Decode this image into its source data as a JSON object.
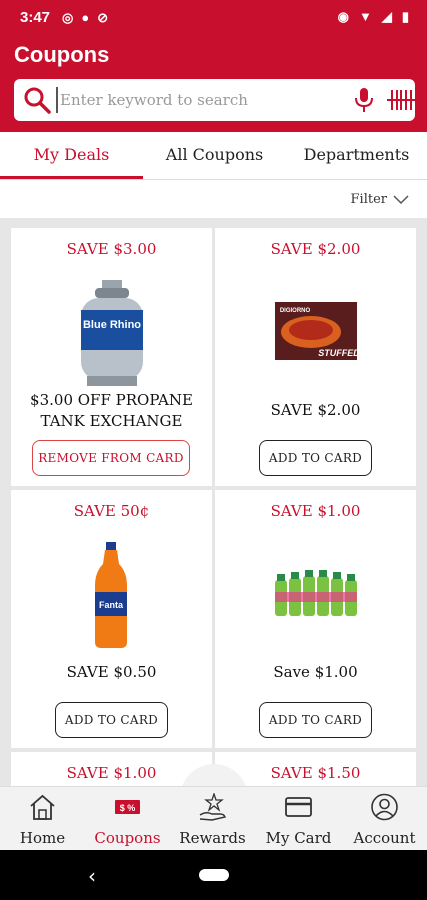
{
  "status_bar": {
    "time": "3:47"
  },
  "header": {
    "title": "Coupons"
  },
  "search": {
    "placeholder": "Enter keyword to search"
  },
  "tabs": [
    {
      "label": "My Deals"
    },
    {
      "label": "All Coupons"
    },
    {
      "label": "Departments"
    }
  ],
  "filter": {
    "label": "Filter"
  },
  "coupons": [
    {
      "save": "SAVE $3.00",
      "desc": "$3.00 OFF PROPANE TANK EXCHANGE",
      "button": "REMOVE FROM CARD",
      "product": "Blue Rhino propane tank",
      "logo_text": "Blue Rhino"
    },
    {
      "save": "SAVE $2.00",
      "desc": "SAVE $2.00",
      "button": "ADD TO CARD",
      "product": "DiGiorno stuffed crust pizza",
      "logo_text": "DIGIORNO",
      "box_text": "STUFFED"
    },
    {
      "save": "SAVE 50¢",
      "desc": "SAVE $0.50",
      "button": "ADD TO CARD",
      "product": "Fanta orange bottle",
      "logo_text": "Fanta"
    },
    {
      "save": "SAVE $1.00",
      "desc": "Save $1.00",
      "button": "ADD TO CARD",
      "product": "Green sports drink multipack"
    },
    {
      "save": "SAVE $1.00"
    },
    {
      "save": "SAVE $1.50"
    }
  ],
  "bottom_nav": [
    {
      "label": "Home",
      "icon": "home-icon"
    },
    {
      "label": "Coupons",
      "icon": "coupons-icon",
      "badge": "$ %"
    },
    {
      "label": "Rewards",
      "icon": "rewards-icon"
    },
    {
      "label": "My Card",
      "icon": "card-icon"
    },
    {
      "label": "Account",
      "icon": "account-icon"
    }
  ],
  "colors": {
    "brand": "#c8102e",
    "background": "#e6e6e6"
  }
}
